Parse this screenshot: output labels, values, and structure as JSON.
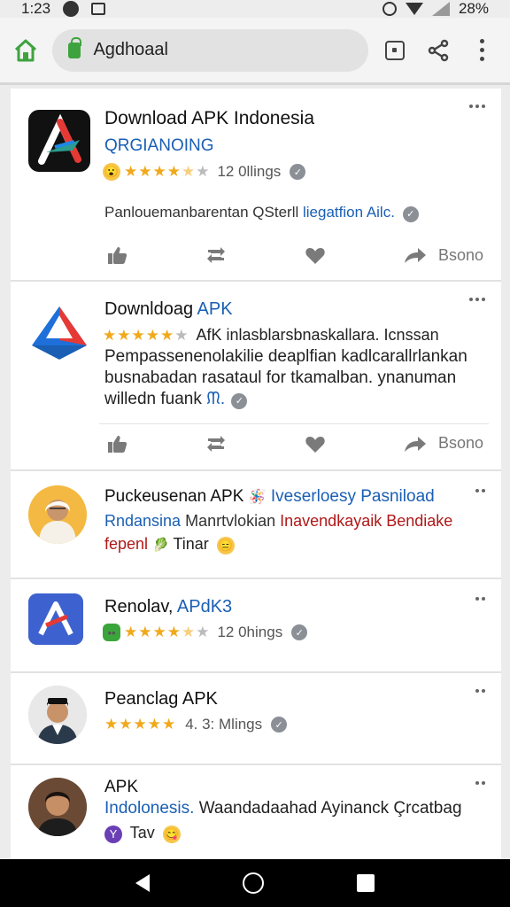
{
  "status_bar": {
    "time": "1:23",
    "battery": "28%",
    "icons": [
      "app-icon",
      "screenshot-icon",
      "alarm-icon",
      "wifi-icon",
      "signal-icon"
    ]
  },
  "browser": {
    "url": "Agdhoaal",
    "icons": [
      "home-icon",
      "lock-icon",
      "tabs-icon",
      "share-icon",
      "overflow-menu-icon"
    ],
    "accent_color": "#3ea33e"
  },
  "cards": [
    {
      "title": "Download APK Indonesia",
      "subtitle": "QRGIANOING",
      "rating_text": "12 0llings",
      "description_plain": "Panlouemanbarentan QSterll",
      "description_link": "liegatfion Ailc.",
      "actions": {
        "share_label": "Bsono"
      }
    },
    {
      "title_main": "Downldoag",
      "title_accent": "APK",
      "body_line1": "AfK inlasblarsbnaskallara. Icnssan",
      "body_line2": "Pempassenenolakilie deaplfian kadlcarallrlankan",
      "body_line3": "busnabadan rasataul for tkamalban. ynanuman",
      "body_line4": "willedn fuank",
      "body_line4_link": "ᙏ.",
      "actions": {
        "share_label": "Bsono"
      }
    },
    {
      "title_main": "Puckeusenan APK",
      "title_accent": "Iveserloesy Pasniload",
      "line2_blue": "Rndansina",
      "line2_dark": "Manrtvlokian",
      "line2_red": "Inavendkayaik Bendiake",
      "line3_red": "fepenl",
      "line3_tail": "Tinar"
    },
    {
      "title_main": "Renolav,",
      "title_accent": "APdK3",
      "rating_text": "12 0hings"
    },
    {
      "title_main": "Peanclag APK",
      "rating_text": "4. 3: Mlings"
    },
    {
      "title_main": "APK",
      "line2_blue": "Indolonesis.",
      "line2_dark": "Waandadaahad Ayinanck Çrcatbag",
      "line3_tail": "Tav"
    }
  ]
}
